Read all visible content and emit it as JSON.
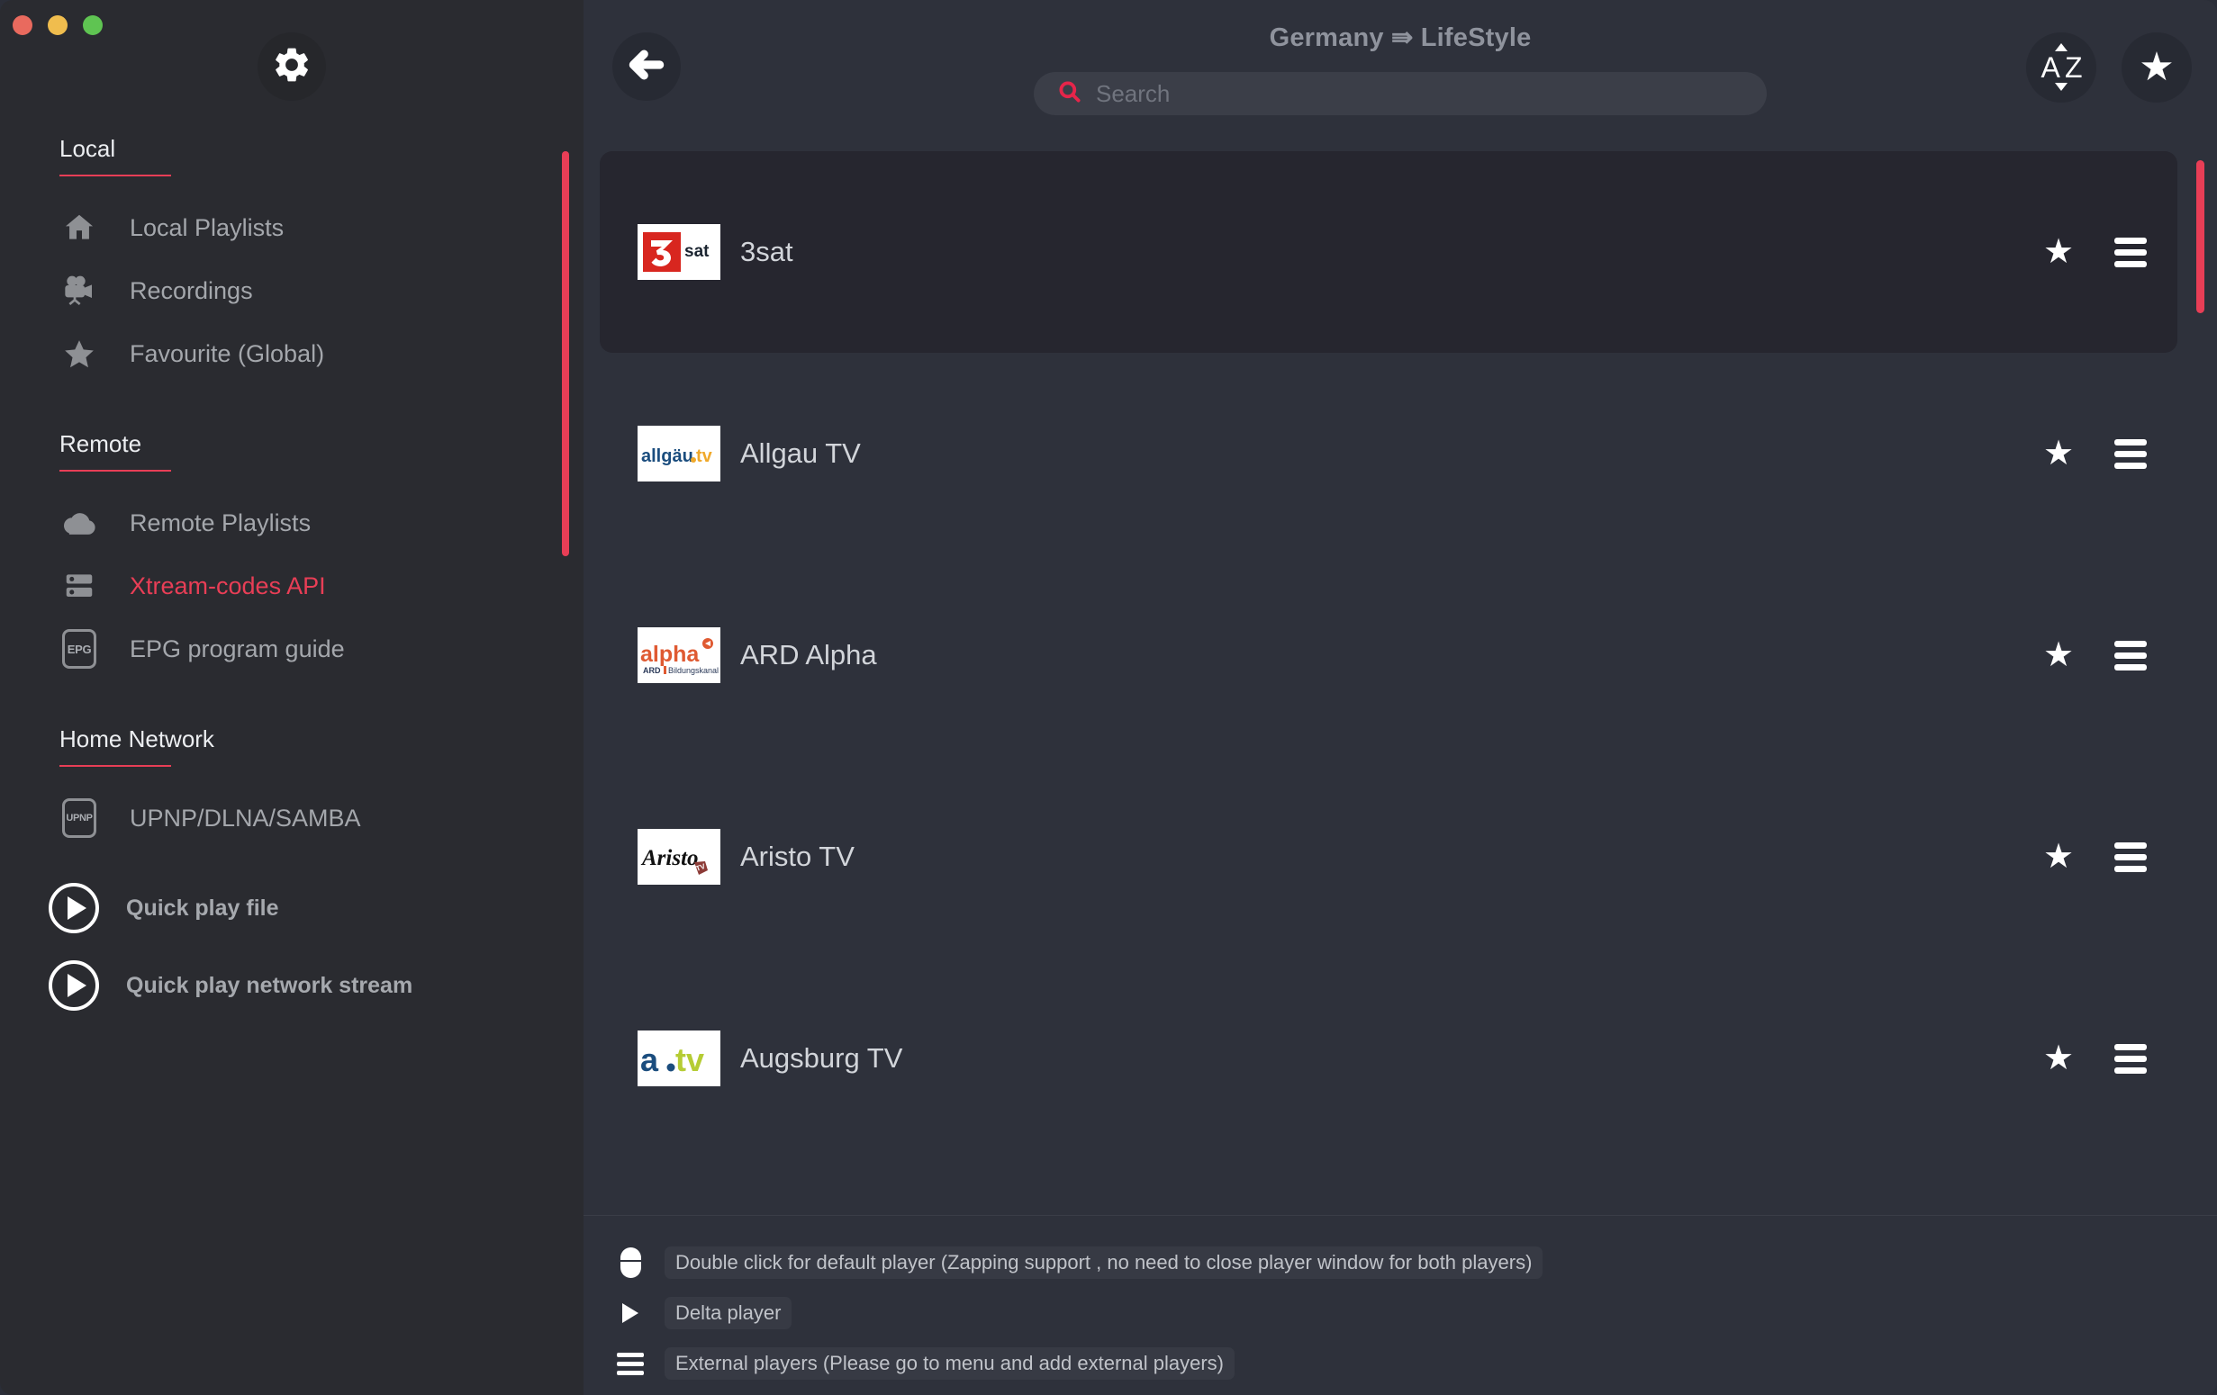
{
  "window": {
    "traffic_lights": [
      "close",
      "minimize",
      "zoom"
    ],
    "colors": {
      "accent": "#e83e56",
      "sidebar_bg": "#2a2b30",
      "main_bg": "#2e313b",
      "selected_row_bg": "#26262f",
      "traffic_red": "#e96a5e",
      "traffic_yellow": "#f0bd4e",
      "traffic_green": "#5fc452"
    }
  },
  "sidebar": {
    "settings_icon": "gear-icon",
    "sections": [
      {
        "title": "Local",
        "items": [
          {
            "label": "Local Playlists",
            "icon": "home-icon",
            "active": false
          },
          {
            "label": "Recordings",
            "icon": "video-camera-icon",
            "active": false
          },
          {
            "label": "Favourite (Global)",
            "icon": "star-icon",
            "active": false
          }
        ]
      },
      {
        "title": "Remote",
        "items": [
          {
            "label": "Remote Playlists",
            "icon": "cloud-icon",
            "active": false
          },
          {
            "label": "Xtream-codes API",
            "icon": "server-icon",
            "active": true
          },
          {
            "label": "EPG program guide",
            "icon": "epg-badge-icon",
            "badge": "EPG",
            "active": false
          }
        ]
      },
      {
        "title": "Home Network",
        "items": [
          {
            "label": "UPNP/DLNA/SAMBA",
            "icon": "upnp-badge-icon",
            "badge": "UPNP",
            "active": false
          }
        ]
      }
    ],
    "quick_actions": [
      {
        "label": "Quick play file",
        "icon": "play-circle-icon"
      },
      {
        "label": "Quick play network stream",
        "icon": "play-circle-icon"
      }
    ]
  },
  "header": {
    "back_icon": "arrow-left-icon",
    "title": "Germany ⇛ LifeStyle",
    "breadcrumb_parent": "Germany",
    "breadcrumb_child": "LifeStyle",
    "search": {
      "placeholder": "Search",
      "value": "",
      "icon": "search-icon"
    },
    "actions": [
      {
        "name": "sort-az-button",
        "label": "A Z",
        "letter_a": "A",
        "letter_z": "Z",
        "icon": "sort-alpha-icon"
      },
      {
        "name": "favourites-filter-button",
        "icon": "star-icon",
        "glyph": "★"
      }
    ]
  },
  "channels": [
    {
      "name": "3sat",
      "logo": "3sat-logo",
      "selected": true,
      "favourite_icon": "star-icon",
      "menu_icon": "hamburger-menu-icon"
    },
    {
      "name": "Allgau TV",
      "logo": "allgau-tv-logo",
      "selected": false,
      "favourite_icon": "star-icon",
      "menu_icon": "hamburger-menu-icon"
    },
    {
      "name": "ARD Alpha",
      "logo": "ard-alpha-logo",
      "selected": false,
      "favourite_icon": "star-icon",
      "menu_icon": "hamburger-menu-icon"
    },
    {
      "name": "Aristo TV",
      "logo": "aristo-tv-logo",
      "selected": false,
      "favourite_icon": "star-icon",
      "menu_icon": "hamburger-menu-icon"
    },
    {
      "name": "Augsburg TV",
      "logo": "augsburg-tv-logo",
      "selected": false,
      "favourite_icon": "star-icon",
      "menu_icon": "hamburger-menu-icon"
    }
  ],
  "legend": [
    {
      "icon": "mouse-icon",
      "text": "Double click for default player (Zapping support , no need to close player window for both players)"
    },
    {
      "icon": "play-triangle-icon",
      "text": "Delta player"
    },
    {
      "icon": "hamburger-menu-icon",
      "text": "External players (Please go to menu and add external players)"
    }
  ]
}
